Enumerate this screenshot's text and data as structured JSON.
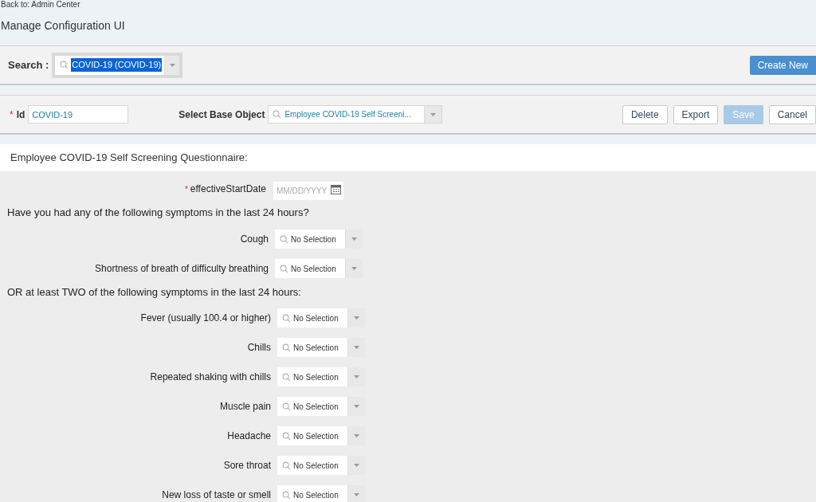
{
  "back_link": "Back to: Admin Center",
  "page_title": "Manage Configuration UI",
  "search": {
    "label": "Search :",
    "value": "COVID-19 (COVID-19)",
    "highlighted": true
  },
  "create_button": "Create New",
  "id_field": {
    "label": "Id",
    "required_mark": "*",
    "value": "COVID-19"
  },
  "base_object": {
    "label": "Select Base Object",
    "value": "Employee COVID-19 Self Screeni..."
  },
  "actions": [
    {
      "label": "Delete",
      "disabled": false
    },
    {
      "label": "Export",
      "disabled": false
    },
    {
      "label": "Save",
      "disabled": true
    },
    {
      "label": "Cancel",
      "disabled": false
    }
  ],
  "form": {
    "title": "Employee COVID-19 Self Screening Questionnaire:",
    "date_field": {
      "label": "effectiveStartDate",
      "required_mark": "*",
      "placeholder": "MM/DD/YYYY"
    },
    "sections": [
      {
        "heading": "Have you had any of the following symptoms in the last 24 hours?",
        "fields": [
          {
            "label": "Cough",
            "value": "No Selection"
          },
          {
            "label": "Shortness of breath of difficulty breathing",
            "value": "No Selection"
          }
        ]
      },
      {
        "heading": "OR at least TWO of the following symptoms in the last 24 hours:",
        "fields": [
          {
            "label": "Fever (usually 100.4 or higher)",
            "value": "No Selection"
          },
          {
            "label": "Chills",
            "value": "No Selection"
          },
          {
            "label": "Repeated shaking with chills",
            "value": "No Selection"
          },
          {
            "label": "Muscle pain",
            "value": "No Selection"
          },
          {
            "label": "Headache",
            "value": "No Selection"
          },
          {
            "label": "Sore throat",
            "value": "No Selection"
          },
          {
            "label": "New loss of taste or smell",
            "value": "No Selection"
          }
        ]
      }
    ]
  }
}
